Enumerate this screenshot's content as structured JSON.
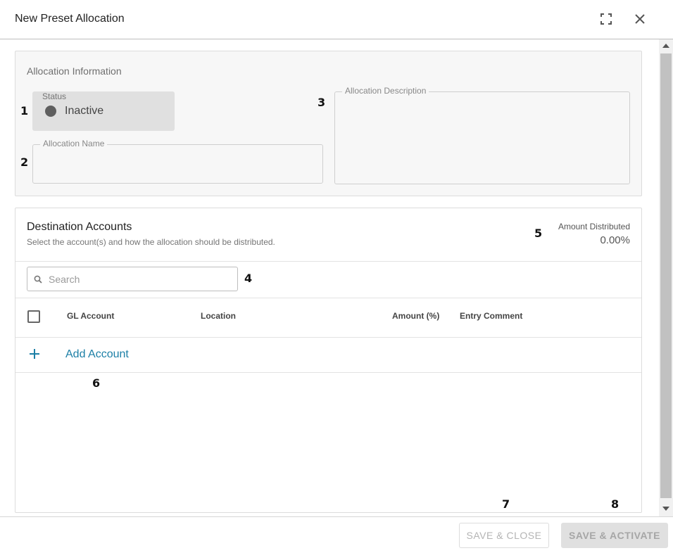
{
  "window": {
    "title": "New Preset Allocation",
    "icons": {
      "expand": "fullscreen-icon",
      "close": "close-icon"
    }
  },
  "allocation_info": {
    "section_title": "Allocation Information",
    "status": {
      "label": "Status",
      "value": "Inactive",
      "dot_color": "#5f5f5f"
    },
    "name_field": {
      "label": "Allocation Name",
      "value": ""
    },
    "description_field": {
      "label": "Allocation Description",
      "value": ""
    }
  },
  "destination_accounts": {
    "title": "Destination Accounts",
    "subtitle": "Select the account(s) and how the allocation should be distributed.",
    "amount_distributed_label": "Amount Distributed",
    "amount_distributed_value": "0.00%",
    "search": {
      "placeholder": "Search",
      "icon": "search-icon"
    },
    "columns": [
      "GL Account",
      "Location",
      "Amount (%)",
      "Entry Comment"
    ],
    "add_account_label": "Add Account",
    "accent_color": "#1c7fa6"
  },
  "annotations": [
    "1",
    "2",
    "3",
    "4",
    "5",
    "6",
    "7",
    "8"
  ],
  "footer": {
    "save_close_label": "SAVE & CLOSE",
    "save_activate_label": "SAVE & ACTIVATE"
  }
}
